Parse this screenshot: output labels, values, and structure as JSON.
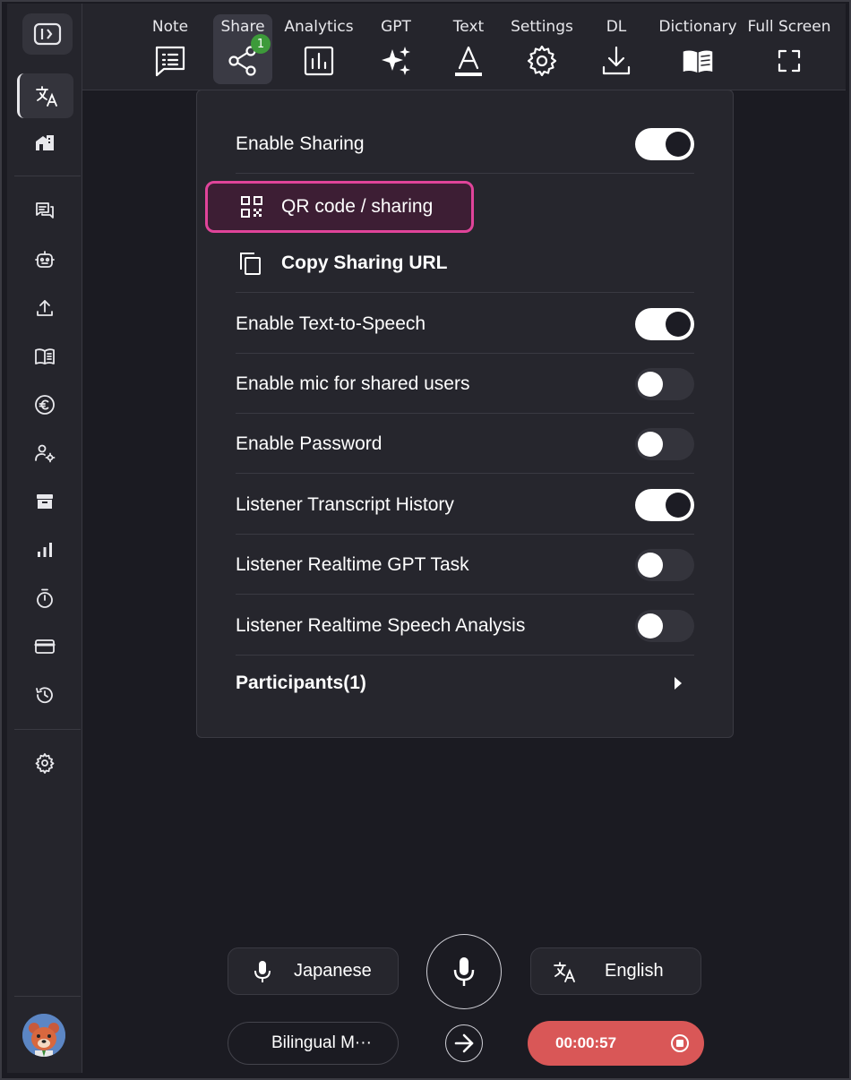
{
  "toolbar": {
    "note": "Note",
    "share": "Share",
    "share_badge": "1",
    "analytics": "Analytics",
    "gpt": "GPT",
    "text": "Text",
    "settings": "Settings",
    "dl": "DL",
    "dictionary": "Dictionary",
    "fullscreen": "Full Screen"
  },
  "sidebar": {
    "items": [
      "panel-toggle",
      "translate",
      "home",
      "chat",
      "bot",
      "upload",
      "book",
      "euro",
      "user-settings",
      "archive",
      "stats",
      "timer",
      "card",
      "history",
      "settings"
    ]
  },
  "share_panel": {
    "enable_sharing": {
      "label": "Enable Sharing",
      "on": true
    },
    "qr_code": "QR code / sharing",
    "copy_url": "Copy Sharing URL",
    "enable_tts": {
      "label": "Enable Text-to-Speech",
      "on": true
    },
    "enable_mic": {
      "label": "Enable mic for shared users",
      "on": false
    },
    "enable_password": {
      "label": "Enable Password",
      "on": false
    },
    "listener_history": {
      "label": "Listener Transcript History",
      "on": true
    },
    "listener_gpt": {
      "label": "Listener Realtime GPT Task",
      "on": false
    },
    "listener_speech": {
      "label": "Listener Realtime Speech Analysis",
      "on": false
    },
    "participants": "Participants(1)"
  },
  "bottom": {
    "source_lang": "Japanese",
    "target_lang": "English",
    "mode": "Bilingual M···",
    "timer": "00:00:57"
  },
  "colors": {
    "accent_pink": "#e0449a",
    "record_red": "#d95757",
    "badge_green": "#3d9a3a"
  }
}
